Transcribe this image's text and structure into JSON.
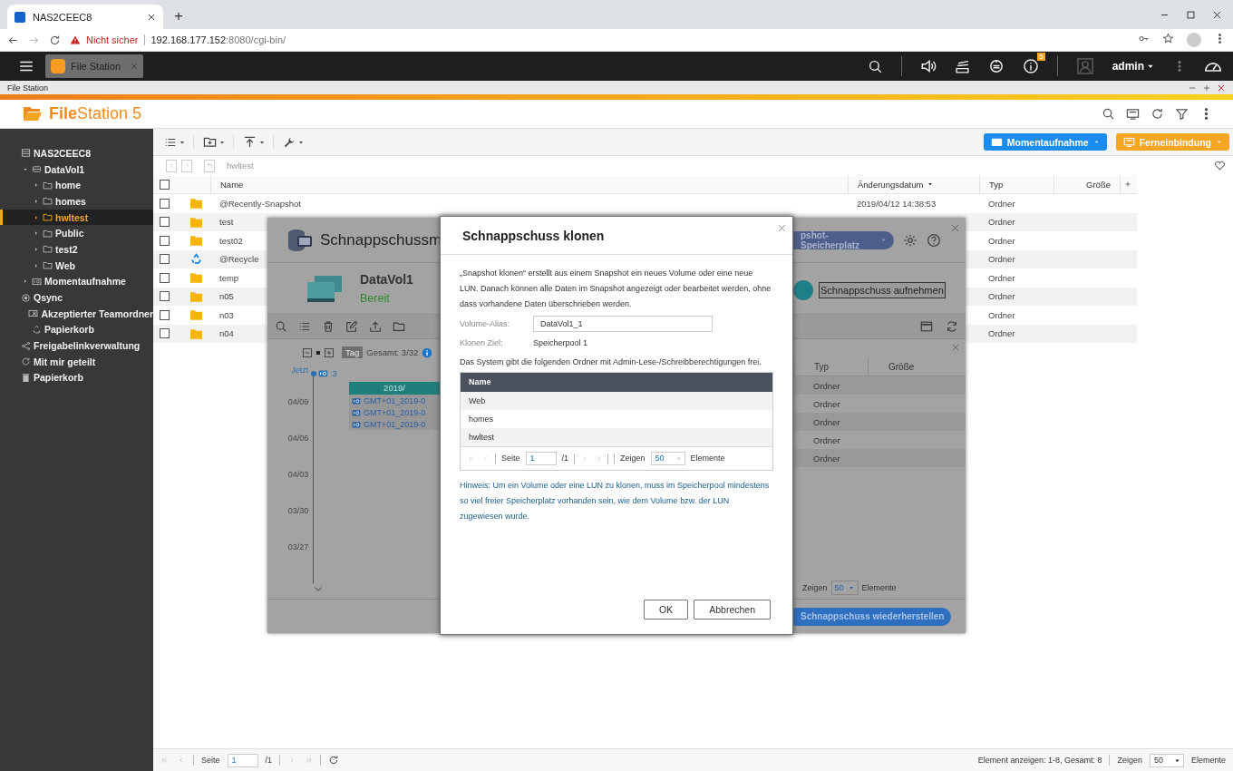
{
  "browser": {
    "tab_title": "NAS2CEEC8",
    "new_tab": "+",
    "security_label": "Nicht sicher",
    "url_host": "192.168.177.152",
    "url_path": ":8080/cgi-bin/"
  },
  "topbar": {
    "app_tab": {
      "label": "File Station",
      "selected": true
    },
    "notifications": "5",
    "user": "admin"
  },
  "app_window": {
    "title": "File Station"
  },
  "logo": {
    "bold": "File",
    "rest": "Station 5"
  },
  "sidebar": {
    "items": [
      {
        "label": "NAS2CEEC8",
        "kind": "nas",
        "selected": false,
        "children": [
          {
            "label": "DataVol1",
            "kind": "volume",
            "selected": false,
            "expanded": true,
            "children": [
              {
                "label": "home",
                "kind": "folder",
                "selected": false,
                "expanded": false
              },
              {
                "label": "homes",
                "kind": "folder",
                "selected": false,
                "expanded": false
              },
              {
                "label": "hwltest",
                "kind": "folder",
                "selected": true,
                "expanded": false
              },
              {
                "label": "Public",
                "kind": "folder",
                "selected": false,
                "expanded": false
              },
              {
                "label": "test2",
                "kind": "folder",
                "selected": false,
                "expanded": false
              },
              {
                "label": "Web",
                "kind": "folder",
                "selected": false,
                "expanded": false
              }
            ]
          },
          {
            "label": "Momentaufnahme",
            "kind": "snapshot",
            "selected": false,
            "expanded": false
          }
        ]
      },
      {
        "label": "Qsync",
        "kind": "qsync",
        "selected": false,
        "children": [
          {
            "label": "Akzeptierter Teamordner",
            "kind": "team",
            "selected": false
          },
          {
            "label": "Papierkorb",
            "kind": "recycle",
            "selected": false
          }
        ]
      },
      {
        "label": "Freigabelinkverwaltung",
        "kind": "share",
        "selected": false
      },
      {
        "label": "Mit mir geteilt",
        "kind": "shared",
        "selected": false
      },
      {
        "label": "Papierkorb",
        "kind": "trash",
        "selected": false
      }
    ]
  },
  "toolbar": {
    "snapshot_button": "Momentaufnahme",
    "mount_button": "Ferneinbindung"
  },
  "breadcrumb": "hwltest",
  "file_table": {
    "select_all": {
      "checked": false
    },
    "columns": [
      {
        "label": "Name",
        "sorted": false
      },
      {
        "label": "Änderungsdatum",
        "sorted": true
      },
      {
        "label": "Typ",
        "sorted": false
      },
      {
        "label": "Größe",
        "sorted": false
      }
    ],
    "rows": [
      {
        "checked": false,
        "kind": "folder",
        "name": "@Recently-Snapshot",
        "modified": "2019/04/12 14:38:53",
        "type": "Ordner"
      },
      {
        "checked": false,
        "kind": "folder",
        "name": "test",
        "type": "Ordner"
      },
      {
        "checked": false,
        "kind": "folder",
        "name": "test02",
        "type": "Ordner"
      },
      {
        "checked": false,
        "kind": "recycle",
        "name": "@Recycle",
        "type": "Ordner"
      },
      {
        "checked": false,
        "kind": "folder",
        "name": "temp",
        "type": "Ordner"
      },
      {
        "checked": false,
        "kind": "folder",
        "name": "n05",
        "type": "Ordner"
      },
      {
        "checked": false,
        "kind": "folder",
        "name": "n03",
        "type": "Ordner"
      },
      {
        "checked": false,
        "kind": "folder",
        "name": "n04",
        "type": "Ordner"
      }
    ]
  },
  "pager": {
    "page_label": "Seite",
    "page": "1",
    "page_total": "/1",
    "summary": "Element anzeigen: 1-8, Gesamt: 8",
    "show_label": "Zeigen",
    "per_page": "50",
    "items_label": "Elemente"
  },
  "snapshot_manager": {
    "title": "Schnappschussm",
    "volume": "DataVol1",
    "status": "Bereit",
    "space_button": "pshot-Speicherplatz",
    "take_button": "Schnappschuss aufnehmen",
    "tag_label": "Tag",
    "total": "Gesamt: 3/32",
    "now_label": "Jetzt",
    "now_count": ":3",
    "dates": [
      "04/09",
      "04/06",
      "04/03",
      "03/30",
      "03/27"
    ],
    "group_header": "2019/",
    "snapshots": [
      "GMT+01_2019-0",
      "GMT+01_2019-0",
      "GMT+01_2019-0"
    ],
    "columns": [
      "Typ",
      "Größe"
    ],
    "rows": [
      "Ordner",
      "Ordner",
      "Ordner",
      "Ordner",
      "Ordner"
    ],
    "show_label": "Zeigen",
    "per_page": "50",
    "items_label": "Elemente",
    "restore_button": "Schnappschuss wiederherstellen"
  },
  "clone_dialog": {
    "title": "Schnappschuss klonen",
    "intro": "„Snapshot klonen“ erstellt aus einem Snapshot ein neues Volume oder eine neue LUN. Danach können alle Daten im Snapshot angezeigt oder bearbeitet werden, ohne dass vorhandene Daten überschrieben werden.",
    "fields": [
      {
        "label": "Volume-Alias:",
        "kind": "input",
        "value": "DataVol1_1"
      },
      {
        "label": "Klonen Ziel:",
        "kind": "text",
        "value": "Speicherpool 1"
      }
    ],
    "folders_note": "Das System gibt die folgenden Ordner mit Admin-Lese-/Schreibberechtigungen frei.",
    "folder_table": {
      "column": "Name",
      "rows": [
        "Web",
        "homes",
        "hwltest"
      ]
    },
    "pager": {
      "page_label": "Seite",
      "page": "1",
      "page_total": "/1",
      "show_label": "Zeigen",
      "per_page": "50",
      "items_label": "Elemente"
    },
    "hint": "Hinweis: Um ein Volume oder eine LUN zu klonen, muss im Speicherpool mindestens so viel freier Speicherplatz vorhanden sein, wie dem Volume bzw. der LUN zugewiesen wurde.",
    "buttons": [
      {
        "label": "OK"
      },
      {
        "label": "Abbrechen"
      }
    ]
  }
}
